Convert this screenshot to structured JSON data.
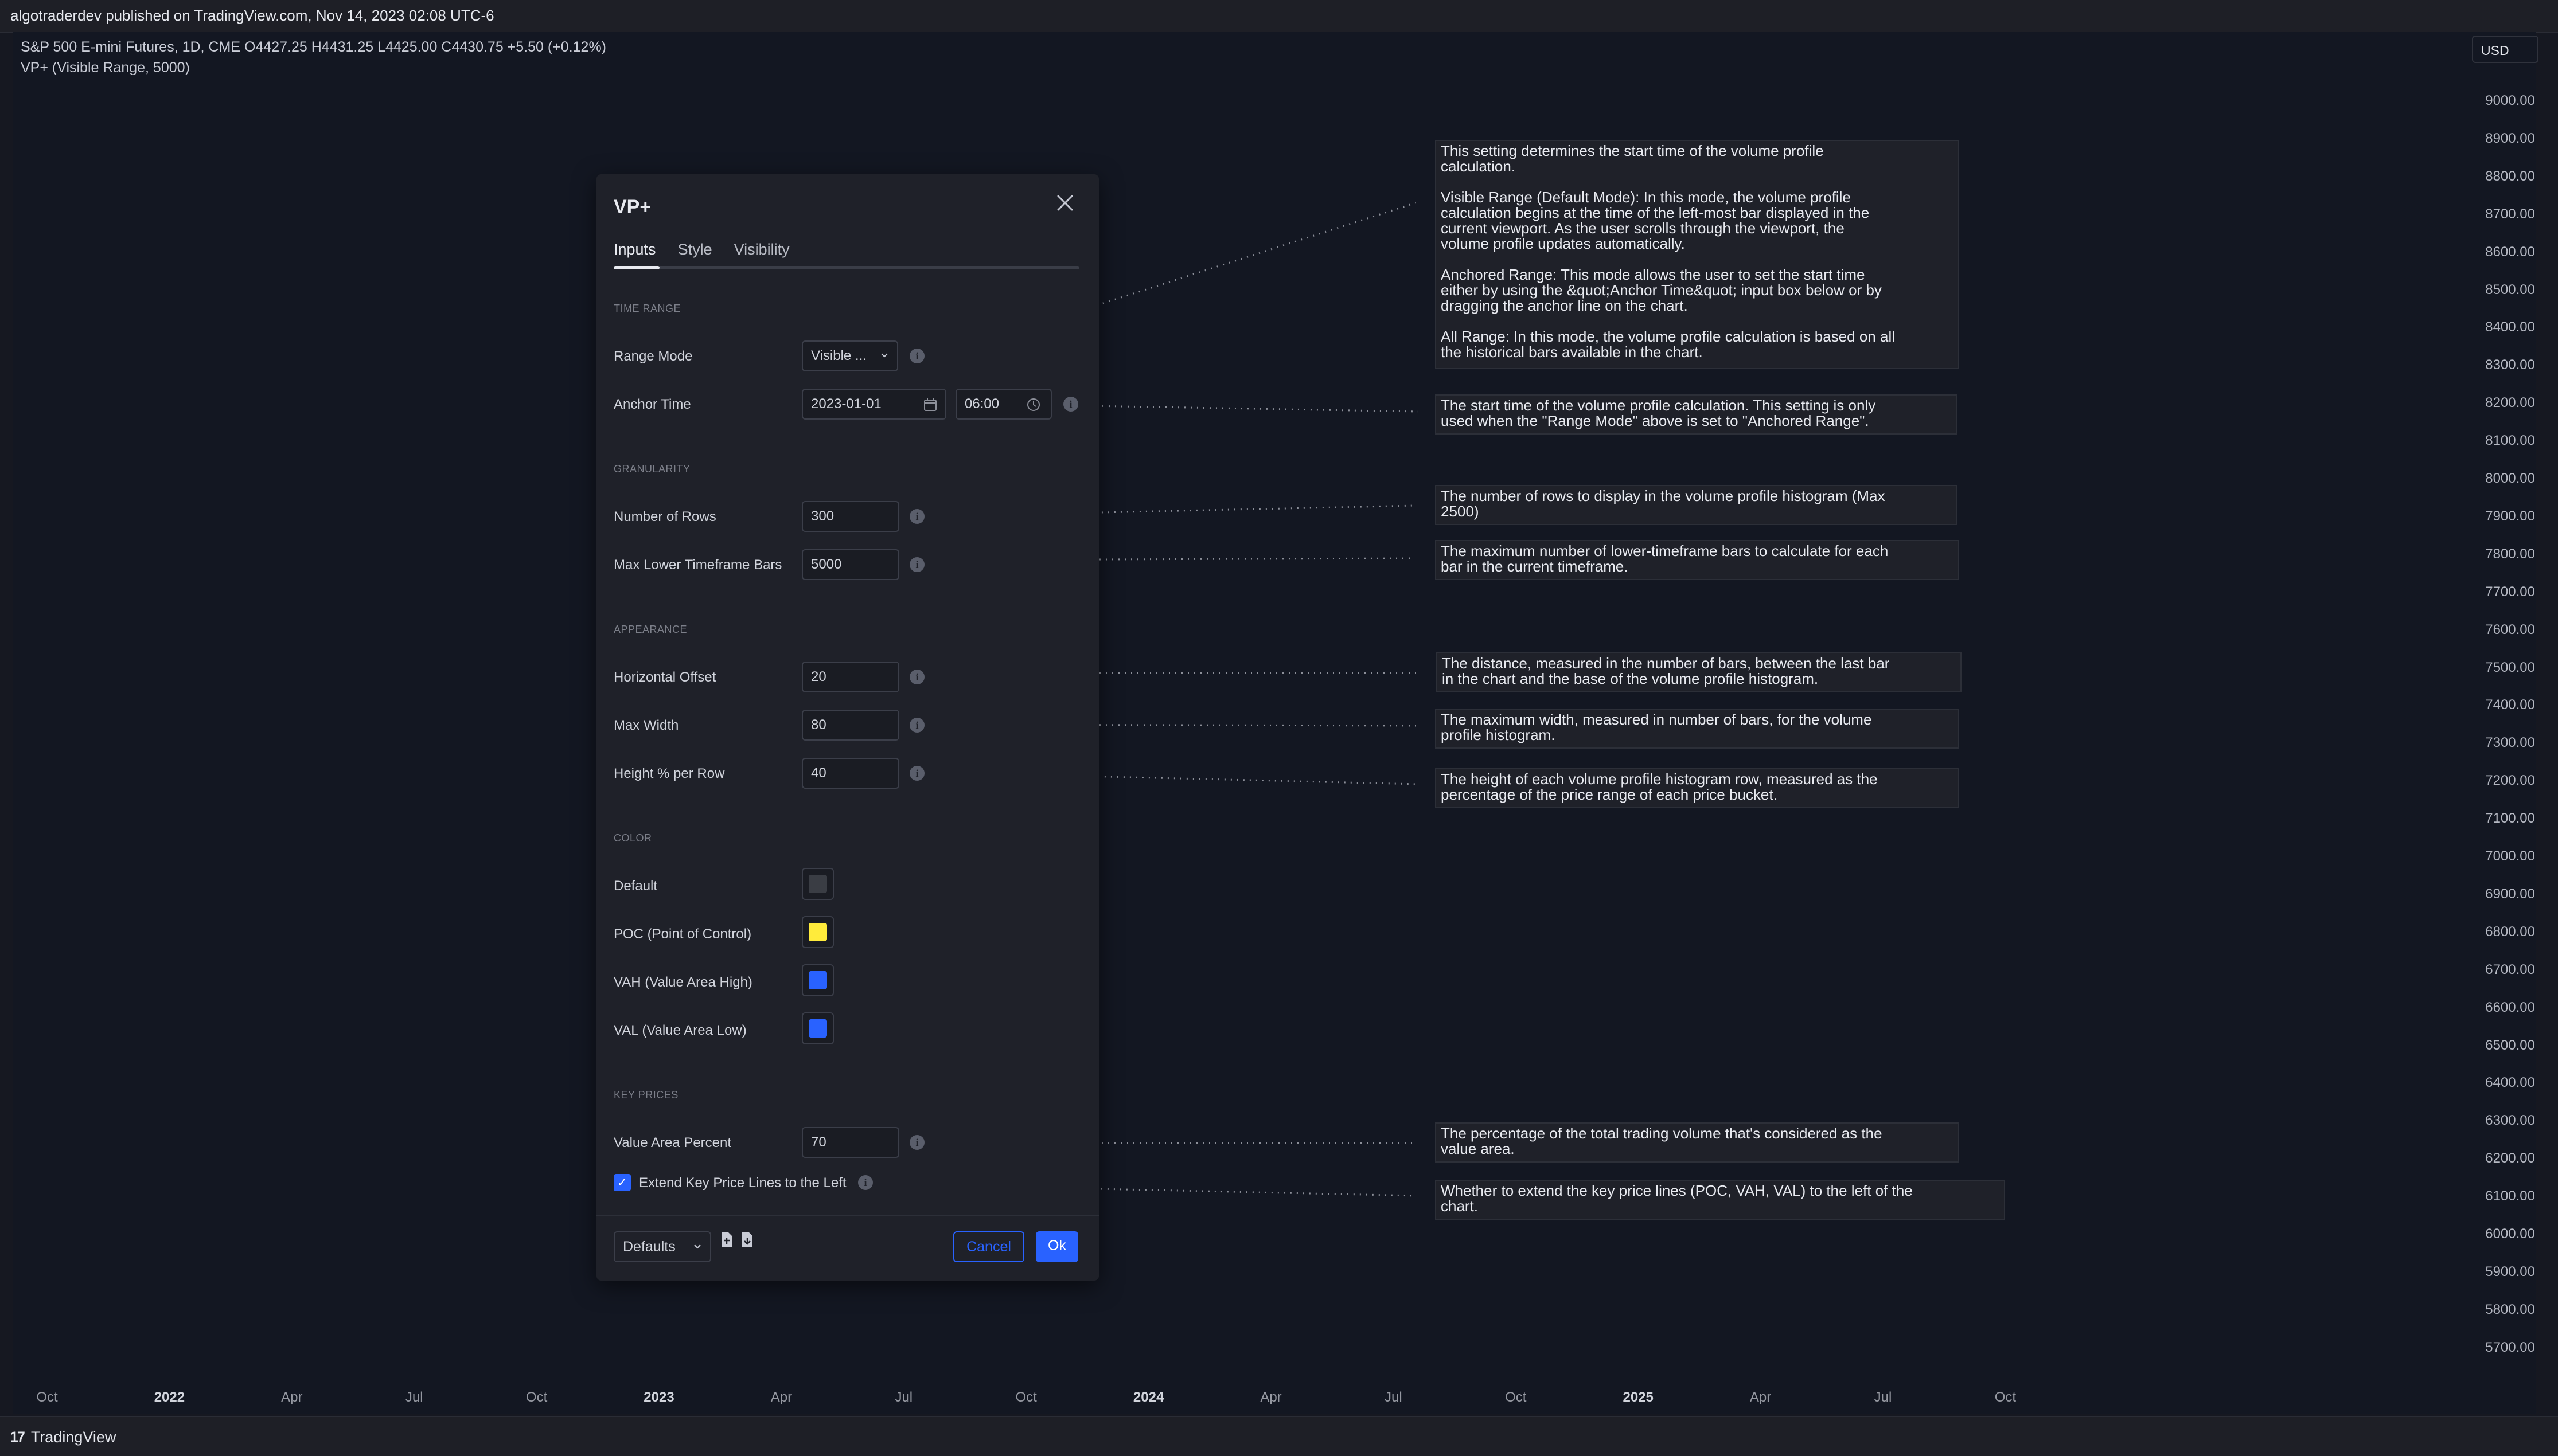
{
  "header": {
    "published": "algotraderdev published on TradingView.com, Nov 14, 2023 02:08 UTC-6"
  },
  "chart": {
    "symbol_line": "S&P 500 E-mini Futures, 1D, CME  O4427.25  H4431.25  L4425.00  C4430.75  +5.50 (+0.12%)",
    "indicator_line": "VP+ (Visible Range, 5000)",
    "currency": "USD",
    "y_ticks": [
      "9000.00",
      "8900.00",
      "8800.00",
      "8700.00",
      "8600.00",
      "8500.00",
      "8400.00",
      "8300.00",
      "8200.00",
      "8100.00",
      "8000.00",
      "7900.00",
      "7800.00",
      "7700.00",
      "7600.00",
      "7500.00",
      "7400.00",
      "7300.00",
      "7200.00",
      "7100.00",
      "7000.00",
      "6900.00",
      "6800.00",
      "6700.00",
      "6600.00",
      "6500.00",
      "6400.00",
      "6300.00",
      "6200.00",
      "6100.00",
      "6000.00",
      "5900.00",
      "5800.00",
      "5700.00"
    ],
    "x_ticks": [
      {
        "label": "Oct",
        "year": false
      },
      {
        "label": "2022",
        "year": true
      },
      {
        "label": "Apr",
        "year": false
      },
      {
        "label": "Jul",
        "year": false
      },
      {
        "label": "Oct",
        "year": false
      },
      {
        "label": "2023",
        "year": true
      },
      {
        "label": "Apr",
        "year": false
      },
      {
        "label": "Jul",
        "year": false
      },
      {
        "label": "Oct",
        "year": false
      },
      {
        "label": "2024",
        "year": true
      },
      {
        "label": "Apr",
        "year": false
      },
      {
        "label": "Jul",
        "year": false
      },
      {
        "label": "Oct",
        "year": false
      },
      {
        "label": "2025",
        "year": true
      },
      {
        "label": "Apr",
        "year": false
      },
      {
        "label": "Jul",
        "year": false
      },
      {
        "label": "Oct",
        "year": false
      }
    ]
  },
  "footer": {
    "brand": "TradingView",
    "logo": "17"
  },
  "dialog": {
    "title": "VP+",
    "tabs": [
      "Inputs",
      "Style",
      "Visibility"
    ],
    "sections": {
      "time_range": "TIME RANGE",
      "granularity": "GRANULARITY",
      "appearance": "APPEARANCE",
      "color": "COLOR",
      "key_prices": "KEY PRICES"
    },
    "fields": {
      "range_mode": {
        "label": "Range Mode",
        "value": "Visible ..."
      },
      "anchor_time": {
        "label": "Anchor Time",
        "date": "2023-01-01",
        "time": "06:00"
      },
      "rows": {
        "label": "Number of Rows",
        "value": "300"
      },
      "max_ltf": {
        "label": "Max Lower Timeframe Bars",
        "value": "5000"
      },
      "h_offset": {
        "label": "Horizontal Offset",
        "value": "20"
      },
      "max_width": {
        "label": "Max Width",
        "value": "80"
      },
      "height_pct": {
        "label": "Height % per Row",
        "value": "40"
      },
      "value_area": {
        "label": "Value Area Percent",
        "value": "70"
      },
      "extend": {
        "label": "Extend Key Price Lines to the Left",
        "checked": true
      }
    },
    "colors": {
      "default": {
        "label": "Default",
        "color": "#3a3d44"
      },
      "poc": {
        "label": "POC (Point of Control)",
        "color": "#ffeb3b"
      },
      "vah": {
        "label": "VAH (Value Area High)",
        "color": "#2962ff"
      },
      "val": {
        "label": "VAL (Value Area Low)",
        "color": "#2962ff"
      }
    },
    "buttons": {
      "defaults": "Defaults",
      "cancel": "Cancel",
      "ok": "Ok"
    }
  },
  "callouts": {
    "range_mode": "This setting determines the start time of the volume profile\ncalculation.\n\nVisible Range (Default Mode): In this mode, the volume profile\ncalculation begins at the time of the left-most bar displayed in the\ncurrent viewport. As the user scrolls through the viewport, the\nvolume profile updates automatically.\n\nAnchored Range: This mode allows the user to set the start time\neither by using the &quot;Anchor Time&quot; input box below or by\ndragging the anchor line on the chart.\n\nAll Range: In this mode, the volume profile calculation is based on all\nthe historical bars available in the chart.",
    "anchor_time": "The start time of the volume profile calculation. This setting is only\nused when the \"Range Mode\" above is set to \"Anchored Range\".",
    "rows": "The number of rows to display in the volume profile histogram (Max\n2500)",
    "max_ltf": "The maximum number of lower-timeframe bars to calculate for each\nbar in the current timeframe.",
    "h_offset": "The distance, measured in the number of bars, between the last bar\nin the chart and the base of the volume profile histogram.",
    "max_width": "The maximum width, measured in number of bars, for the volume\nprofile histogram.",
    "height_pct": "The height of each volume profile histogram row, measured as the\npercentage of the price range of each price bucket.",
    "value_area": "The percentage of the total trading volume that's considered as the\nvalue area.",
    "extend": "Whether to extend the key price lines (POC, VAH, VAL) to the left of the\nchart."
  }
}
